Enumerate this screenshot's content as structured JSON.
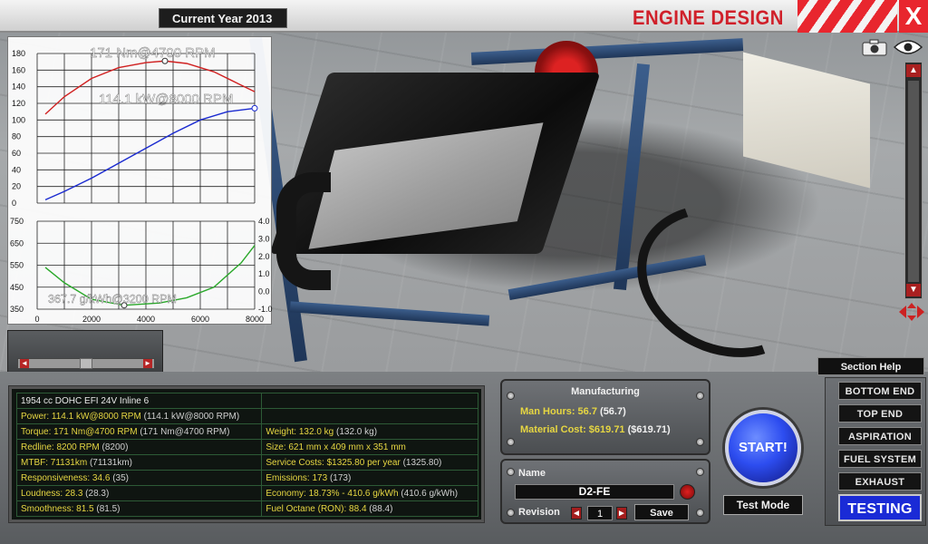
{
  "header": {
    "year_label": "Current Year 2013",
    "title": "ENGINE DESIGN",
    "close_label": "X"
  },
  "chart_data": [
    {
      "type": "line",
      "title": "",
      "xlabel": "",
      "ylabel": "",
      "ylim": [
        0,
        180
      ],
      "xlim": [
        0,
        8000
      ],
      "y_ticks": [
        0,
        20,
        40,
        60,
        80,
        100,
        120,
        140,
        160,
        180
      ],
      "annotations": [
        "171 Nm@4700 RPM",
        "114.1 kW@8000 RPM"
      ],
      "series": [
        {
          "color": "#d02020",
          "x": [
            300,
            1000,
            2000,
            3000,
            4000,
            4700,
            5500,
            6500,
            7500,
            8000
          ],
          "values": [
            107,
            128,
            150,
            163,
            169,
            171,
            168,
            158,
            142,
            134
          ]
        },
        {
          "color": "#1a2ad0",
          "x": [
            300,
            1000,
            2000,
            3000,
            4000,
            5000,
            6000,
            7000,
            8000
          ],
          "values": [
            4,
            14,
            30,
            48,
            66,
            84,
            100,
            110,
            114.1
          ]
        }
      ]
    },
    {
      "type": "line",
      "title": "",
      "xlabel": "",
      "ylabel": "",
      "ylim": [
        350,
        750
      ],
      "y2lim": [
        -1.0,
        4.0
      ],
      "xlim": [
        0,
        8000
      ],
      "x_ticks": [
        0,
        2000,
        4000,
        6000,
        8000
      ],
      "y_ticks": [
        350,
        450,
        550,
        650,
        750
      ],
      "y2_ticks": [
        "-1.0",
        "0.0",
        "1.0",
        "2.0",
        "3.0",
        "4.0"
      ],
      "annotations": [
        "367.7 g/kWh@3200 RPM"
      ],
      "series": [
        {
          "color": "#2aa82a",
          "x": [
            300,
            1000,
            2000,
            3200,
            4500,
            5500,
            6500,
            7500,
            8000
          ],
          "values": [
            540,
            470,
            395,
            367.7,
            378,
            402,
            450,
            560,
            640
          ]
        }
      ]
    }
  ],
  "slider": {
    "left_arrow": "◄",
    "right_arrow": "►"
  },
  "stats": {
    "engine_name": "1954 cc DOHC EFI 24V Inline 6",
    "power": "Power: 114.1 kW@8000 RPM",
    "power_ref": "(114.1 kW@8000 RPM)",
    "torque": "Torque: 171 Nm@4700 RPM",
    "torque_ref": "(171 Nm@4700 RPM)",
    "redline": "Redline: 8200 RPM",
    "redline_ref": "(8200)",
    "mtbf": "MTBF: 71131km",
    "mtbf_ref": "(71131km)",
    "responsiveness": "Responsiveness: 34.6",
    "responsiveness_ref": "(35)",
    "loudness": "Loudness: 28.3",
    "loudness_ref": "(28.3)",
    "smoothness": "Smoothness: 81.5",
    "smoothness_ref": "(81.5)",
    "weight": "Weight: 132.0 kg",
    "weight_ref": "(132.0 kg)",
    "size": "Size: 621 mm x 409 mm x 351 mm",
    "service": "Service Costs: $1325.80 per year",
    "service_ref": "(1325.80)",
    "emissions": "Emissions: 173",
    "emissions_ref": "(173)",
    "economy": "Economy: 18.73% - 410.6 g/kWh",
    "economy_ref": "(410.6 g/kWh)",
    "octane": "Fuel Octane (RON): 88.4",
    "octane_ref": "(88.4)"
  },
  "manufacturing": {
    "title": "Manufacturing",
    "man_hours": "Man Hours: 56.7",
    "man_hours_ref": "(56.7)",
    "material_cost": "Material Cost: $619.71",
    "material_cost_ref": "($619.71)"
  },
  "name_panel": {
    "name_label": "Name",
    "name_value": "D2-FE",
    "revision_label": "Revision",
    "revision_value": "1",
    "save_label": "Save"
  },
  "actions": {
    "start_label": "START!",
    "test_mode_label": "Test Mode",
    "section_help_label": "Section Help"
  },
  "sections": [
    {
      "label": "BOTTOM END"
    },
    {
      "label": "TOP END"
    },
    {
      "label": "ASPIRATION"
    },
    {
      "label": "FUEL SYSTEM"
    },
    {
      "label": "EXHAUST"
    },
    {
      "label": "TESTING",
      "active": true
    }
  ]
}
